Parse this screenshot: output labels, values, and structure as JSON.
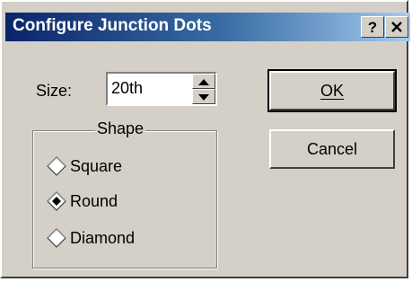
{
  "window": {
    "title": "Configure Junction Dots",
    "help_label": "?",
    "close_label": "✕"
  },
  "size": {
    "label": "Size:",
    "value": "20th"
  },
  "shape": {
    "legend": "Shape",
    "options": [
      {
        "label": "Square",
        "selected": false
      },
      {
        "label": "Round",
        "selected": true
      },
      {
        "label": "Diamond",
        "selected": false
      }
    ]
  },
  "buttons": {
    "ok_label": "OK",
    "cancel_label": "Cancel"
  },
  "colors": {
    "face": "#d4d0c8",
    "title_start": "#0a246a",
    "title_end": "#a6caf0"
  }
}
